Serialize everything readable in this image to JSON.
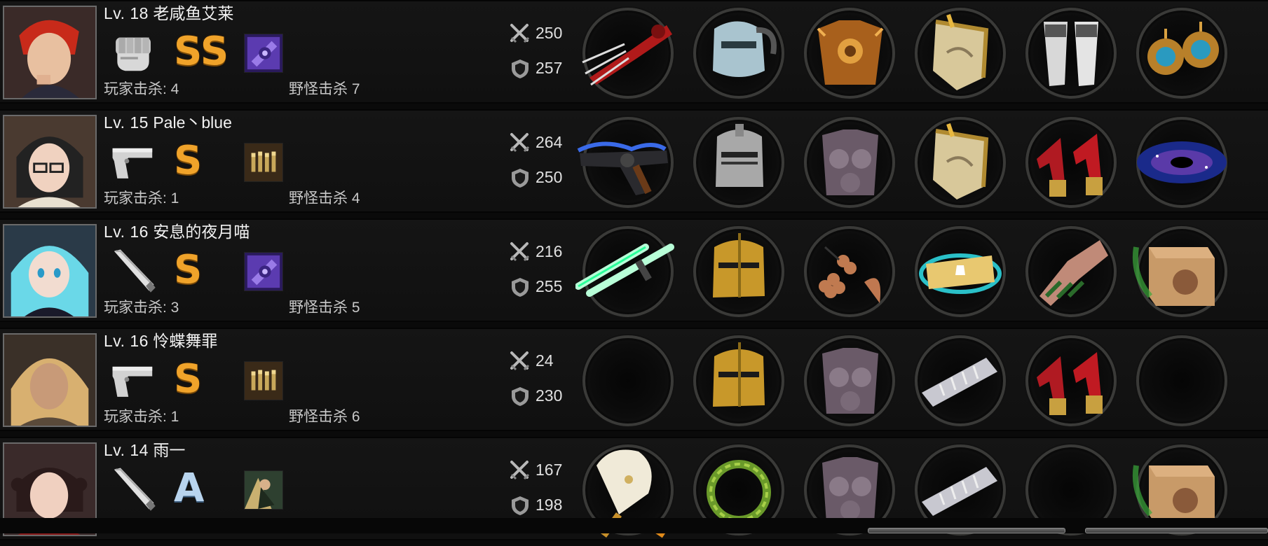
{
  "players": [
    {
      "level": "Lv. 18",
      "name": "老咸鱼艾莱",
      "weapon_type": "fist-icon",
      "rank": "SS",
      "rank_color": "#f0a32a",
      "skill_icon": "purple-gear-skill-icon",
      "player_kills": "玩家击杀: 4",
      "monster_kills": "野怪击杀 7",
      "attack": "250",
      "defense": "257",
      "items": [
        "red-claw-gauntlet-icon",
        "silver-knight-helmet-icon",
        "bronze-chest-armor-icon",
        "golden-shield-icon",
        "silver-greaves-icon",
        "blue-gem-earrings-icon"
      ]
    },
    {
      "level": "Lv. 15",
      "name": "Pale丶blue",
      "weapon_type": "pistol-icon",
      "rank": "S",
      "rank_color": "#f0a32a",
      "skill_icon": "bullets-skill-icon",
      "player_kills": "玩家击杀: 1",
      "monster_kills": "野怪击杀 4",
      "attack": "264",
      "defense": "250",
      "items": [
        "blue-flame-revolver-icon",
        "iron-helmet-icon",
        "stone-armor-icon",
        "golden-shield-icon",
        "red-high-heels-icon",
        "galaxy-orb-icon"
      ]
    },
    {
      "level": "Lv. 16",
      "name": "安息的夜月喵",
      "weapon_type": "bat-icon",
      "rank": "S",
      "rank_color": "#f0a32a",
      "skill_icon": "purple-gear-skill-icon",
      "player_kills": "玩家击杀: 3",
      "monster_kills": "野怪击杀 5",
      "attack": "216",
      "defense": "255",
      "items": [
        "green-light-sabers-icon",
        "golden-helmet-icon",
        "grape-accessory-icon",
        "gold-bracelet-icon",
        "copper-gauntlet-icon",
        "mystery-box-icon"
      ]
    },
    {
      "level": "Lv. 16",
      "name": "怜蝶舞罪",
      "weapon_type": "pistol-icon",
      "rank": "S",
      "rank_color": "#f0a32a",
      "skill_icon": "bullets-skill-icon",
      "player_kills": "玩家击杀: 1",
      "monster_kills": "野怪击杀 6",
      "attack": "24",
      "defense": "230",
      "items": [
        "",
        "golden-helmet-icon",
        "stone-armor-icon",
        "silver-vambrace-icon",
        "red-high-heels-icon",
        ""
      ]
    },
    {
      "level": "Lv. 14",
      "name": "雨一",
      "weapon_type": "bat-icon",
      "rank": "A",
      "rank_color": "#b8d4ee",
      "skill_icon": "dancer-skill-icon",
      "player_kills": "",
      "monster_kills": "",
      "attack": "167",
      "defense": "198",
      "items": [
        "white-fan-icon",
        "laurel-wreath-icon",
        "stone-armor-icon",
        "silver-vambrace-icon",
        "",
        "mystery-box-icon"
      ]
    }
  ]
}
